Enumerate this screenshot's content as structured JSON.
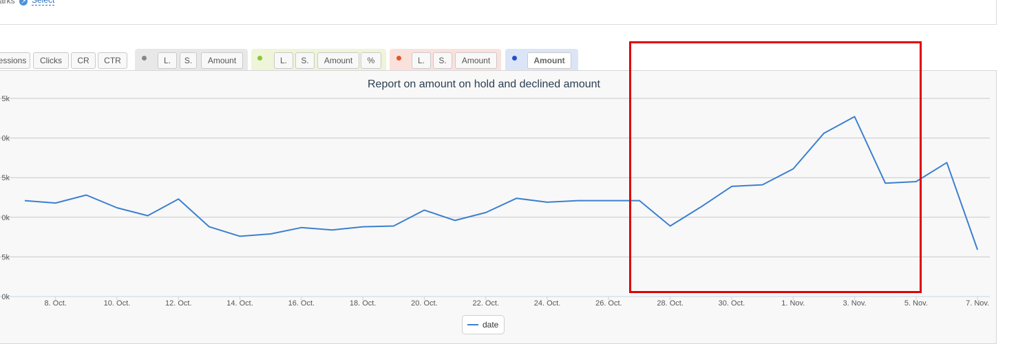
{
  "top": {
    "label": "arks",
    "select_link": "Select"
  },
  "tabs": {
    "group1": [
      "essions",
      "Clicks",
      "CR",
      "CTR"
    ],
    "group2": [
      "L.",
      "S.",
      "Amount"
    ],
    "group3": [
      "L.",
      "S.",
      "Amount",
      "%"
    ],
    "group4": [
      "L.",
      "S.",
      "Amount"
    ],
    "group5": [
      "Amount"
    ]
  },
  "colors": {
    "series": "#3a7fd0",
    "group2_dot": "#888888",
    "group3_dot": "#8cc63f",
    "group4_dot": "#e2572b",
    "group5_dot": "#2650c4",
    "highlight": "#e00000"
  },
  "chart_data": {
    "type": "line",
    "title": "Report on amount on hold and declined amount",
    "y_tick_labels": [
      "0k",
      "5k",
      "0k",
      "5k",
      "0k",
      "5k"
    ],
    "ylim": [
      0,
      25
    ],
    "x_tick_labels": [
      "8. Oct.",
      "10. Oct.",
      "12. Oct.",
      "14. Oct.",
      "16. Oct.",
      "18. Oct.",
      "20. Oct.",
      "22. Oct.",
      "24. Oct.",
      "26. Oct.",
      "28. Oct.",
      "30. Oct.",
      "1. Nov.",
      "3. Nov.",
      "5. Nov.",
      "7. Nov."
    ],
    "x": [
      "7. Oct.",
      "8. Oct.",
      "9. Oct.",
      "10. Oct.",
      "11. Oct.",
      "12. Oct.",
      "13. Oct.",
      "14. Oct.",
      "15. Oct.",
      "16. Oct.",
      "17. Oct.",
      "18. Oct.",
      "19. Oct.",
      "20. Oct.",
      "21. Oct.",
      "22. Oct.",
      "23. Oct.",
      "24. Oct.",
      "25. Oct.",
      "26. Oct.",
      "27. Oct.",
      "28. Oct.",
      "29. Oct.",
      "30. Oct.",
      "31. Oct.",
      "1. Nov.",
      "2. Nov.",
      "3. Nov.",
      "4. Nov.",
      "5. Nov.",
      "6. Nov.",
      "7. Nov."
    ],
    "series": [
      {
        "name": "date",
        "values": [
          12.1,
          11.8,
          12.8,
          11.2,
          10.2,
          12.3,
          8.8,
          7.6,
          7.9,
          8.7,
          8.4,
          8.8,
          8.9,
          10.9,
          9.6,
          10.6,
          12.4,
          11.9,
          12.1,
          12.1,
          12.1,
          8.9,
          11.3,
          13.9,
          14.1,
          16.1,
          20.6,
          22.7,
          14.3,
          14.5,
          16.9,
          5.9
        ]
      }
    ],
    "legend_position": "bottom-center",
    "grid": true
  }
}
